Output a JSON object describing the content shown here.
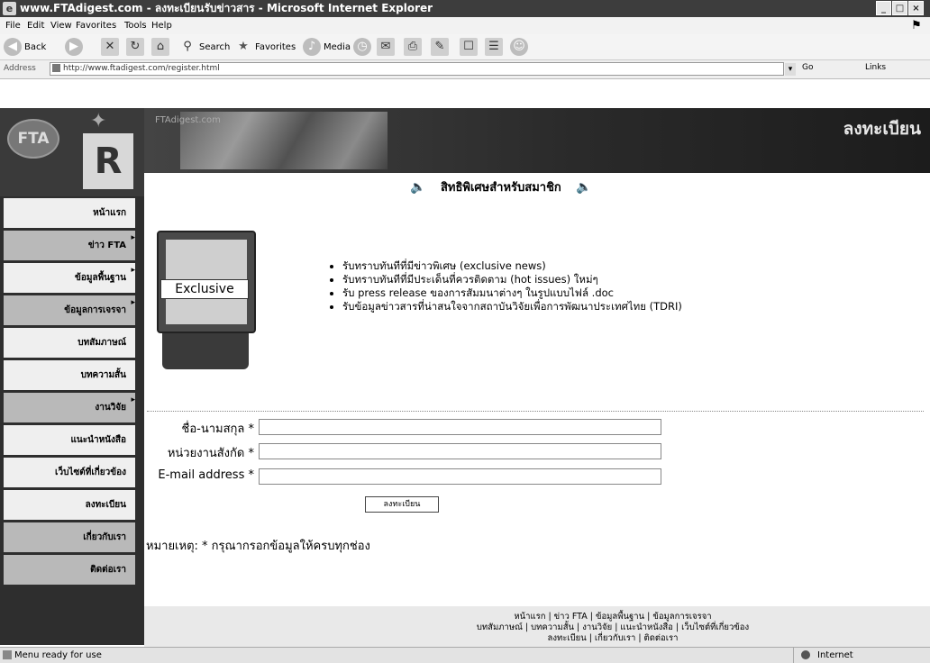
{
  "window": {
    "title": "www.FTAdigest.com - ลงทะเบียนรับข่าวสาร - Microsoft Internet Explorer",
    "buttons": [
      "_",
      "□",
      "×"
    ]
  },
  "menu": [
    "File",
    "Edit",
    "View",
    "Favorites",
    "Tools",
    "Help"
  ],
  "toolbar": {
    "back": "Back",
    "search": "Search",
    "favorites": "Favorites",
    "media": "Media"
  },
  "address": {
    "label": "Address",
    "url": "http://www.ftadigest.com/register.html",
    "go": "Go",
    "links": "Links"
  },
  "banner": {
    "site": "FTAdigest.com",
    "heading": "ลงทะเบียน"
  },
  "logo": {
    "text": "FTA",
    "letter": "R"
  },
  "nav": [
    {
      "label": "หน้าแรก"
    },
    {
      "label": "ข่าว FTA"
    },
    {
      "label": "ข้อมูลพื้นฐาน"
    },
    {
      "label": "ข้อมูลการเจรจา"
    },
    {
      "label": "บทสัมภาษณ์"
    },
    {
      "label": "บทความสั้น"
    },
    {
      "label": "งานวิจัย"
    },
    {
      "label": "แนะนำหนังสือ"
    },
    {
      "label": "เว็บไซต์ที่เกี่ยวข้อง"
    },
    {
      "label": "ลงทะเบียน"
    },
    {
      "label": "เกี่ยวกับเรา"
    },
    {
      "label": "ติดต่อเรา"
    }
  ],
  "main": {
    "benefit_title": "สิทธิพิเศษสำหรับสมาชิก",
    "monitor_label": "Exclusive",
    "benefits": [
      "รับทราบทันทีที่มีข่าวพิเศษ (exclusive news)",
      "รับทราบทันทีที่มีประเด็นที่ควรติดตาม (hot issues) ใหม่ๆ",
      "รับ press release ของการสัมมนาต่างๆ ในรูปแบบไฟล์ .doc",
      "รับข้อมูลข่าวสารที่น่าสนใจจากสถาบันวิจัยเพื่อการพัฒนาประเทศไทย (TDRI)"
    ],
    "form": {
      "name_label": "ชื่อ-นามสกุล",
      "org_label": "หน่วยงานสังกัด",
      "email_label": "E-mail address",
      "required_mark": "*",
      "submit": "ลงทะเบียน"
    },
    "note": "หมายเหตุ: * กรุณากรอกข้อมูลให้ครบทุกช่อง"
  },
  "footer": {
    "line1": "หน้าแรก | ข่าว FTA | ข้อมูลพื้นฐาน | ข้อมูลการเจรจา",
    "line2": "บทสัมภาษณ์ | บทความสั้น | งานวิจัย | แนะนำหนังสือ | เว็บไซต์ที่เกี่ยวข้อง",
    "line3": "ลงทะเบียน | เกี่ยวกับเรา | ติดต่อเรา"
  },
  "status": {
    "text": "Menu ready for use",
    "zone": "Internet"
  }
}
